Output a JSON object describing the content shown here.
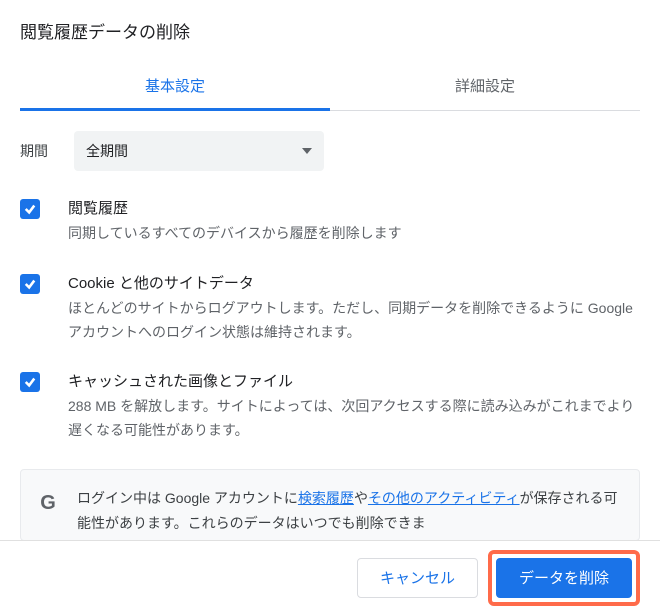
{
  "title": "閲覧履歴データの削除",
  "tabs": {
    "basic": "基本設定",
    "advanced": "詳細設定"
  },
  "time_range": {
    "label": "期間",
    "selected": "全期間"
  },
  "options": [
    {
      "title": "閲覧履歴",
      "desc": "同期しているすべてのデバイスから履歴を削除します",
      "checked": true
    },
    {
      "title": "Cookie と他のサイトデータ",
      "desc": "ほとんどのサイトからログアウトします。ただし、同期データを削除できるように Google アカウントへのログイン状態は維持されます。",
      "checked": true
    },
    {
      "title": "キャッシュされた画像とファイル",
      "desc": "288 MB を解放します。サイトによっては、次回アクセスする際に読み込みがこれまでより遅くなる可能性があります。",
      "checked": true
    }
  ],
  "info": {
    "pre": "ログイン中は Google アカウントに",
    "link1": "検索履歴",
    "mid": "や",
    "link2": "その他のアクティビティ",
    "post": "が保存される可能性があります。これらのデータはいつでも削除できま"
  },
  "buttons": {
    "cancel": "キャンセル",
    "clear": "データを削除"
  }
}
